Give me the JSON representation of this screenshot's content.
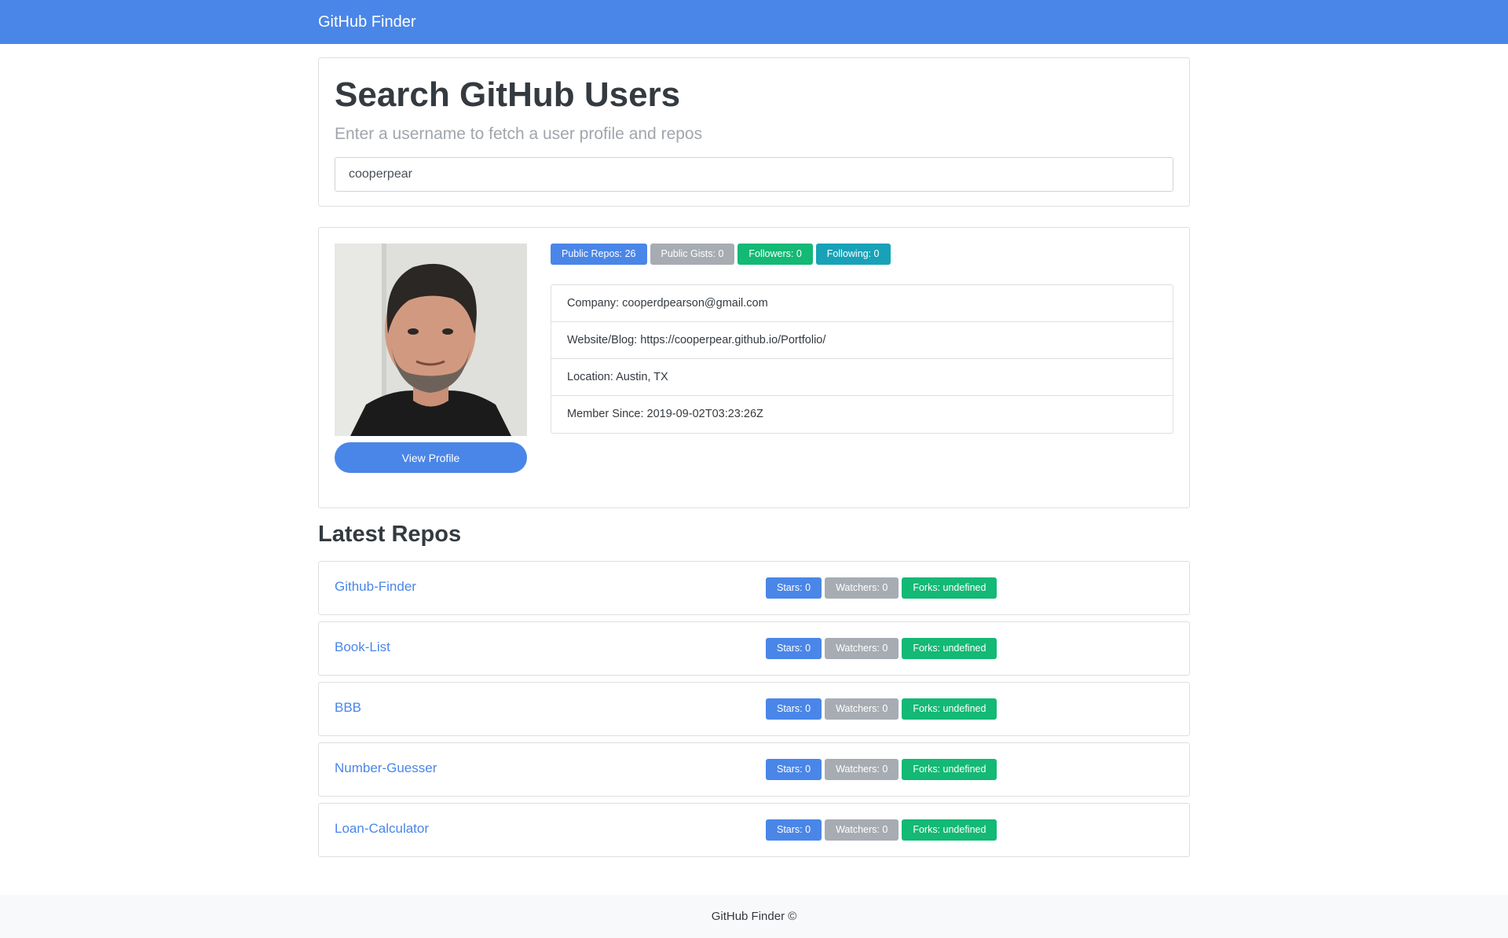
{
  "navbar": {
    "brand": "GitHub Finder"
  },
  "search": {
    "title": "Search GitHub Users",
    "subtitle": "Enter a username to fetch a user profile and repos",
    "input_value": "cooperpear"
  },
  "profile": {
    "avatar_icon": "user-photo",
    "view_profile_label": "View Profile",
    "badges": {
      "public_repos": "Public Repos: 26",
      "public_gists": "Public Gists: 0",
      "followers": "Followers: 0",
      "following": "Following: 0"
    },
    "details": {
      "company": "Company: cooperdpearson@gmail.com",
      "website": "Website/Blog: https://cooperpear.github.io/Portfolio/",
      "location": "Location: Austin, TX",
      "member_since": "Member Since: 2019-09-02T03:23:26Z"
    }
  },
  "repos": {
    "heading": "Latest Repos",
    "items": [
      {
        "name": "Github-Finder",
        "stars": "Stars: 0",
        "watchers": "Watchers: 0",
        "forks": "Forks: undefined"
      },
      {
        "name": "Book-List",
        "stars": "Stars: 0",
        "watchers": "Watchers: 0",
        "forks": "Forks: undefined"
      },
      {
        "name": "BBB",
        "stars": "Stars: 0",
        "watchers": "Watchers: 0",
        "forks": "Forks: undefined"
      },
      {
        "name": "Number-Guesser",
        "stars": "Stars: 0",
        "watchers": "Watchers: 0",
        "forks": "Forks: undefined"
      },
      {
        "name": "Loan-Calculator",
        "stars": "Stars: 0",
        "watchers": "Watchers: 0",
        "forks": "Forks: undefined"
      }
    ]
  },
  "footer": {
    "text": "GitHub Finder ©"
  },
  "colors": {
    "primary": "#4a86e8",
    "secondary": "#a7acb3",
    "success": "#13b975",
    "info": "#17a2b8"
  }
}
